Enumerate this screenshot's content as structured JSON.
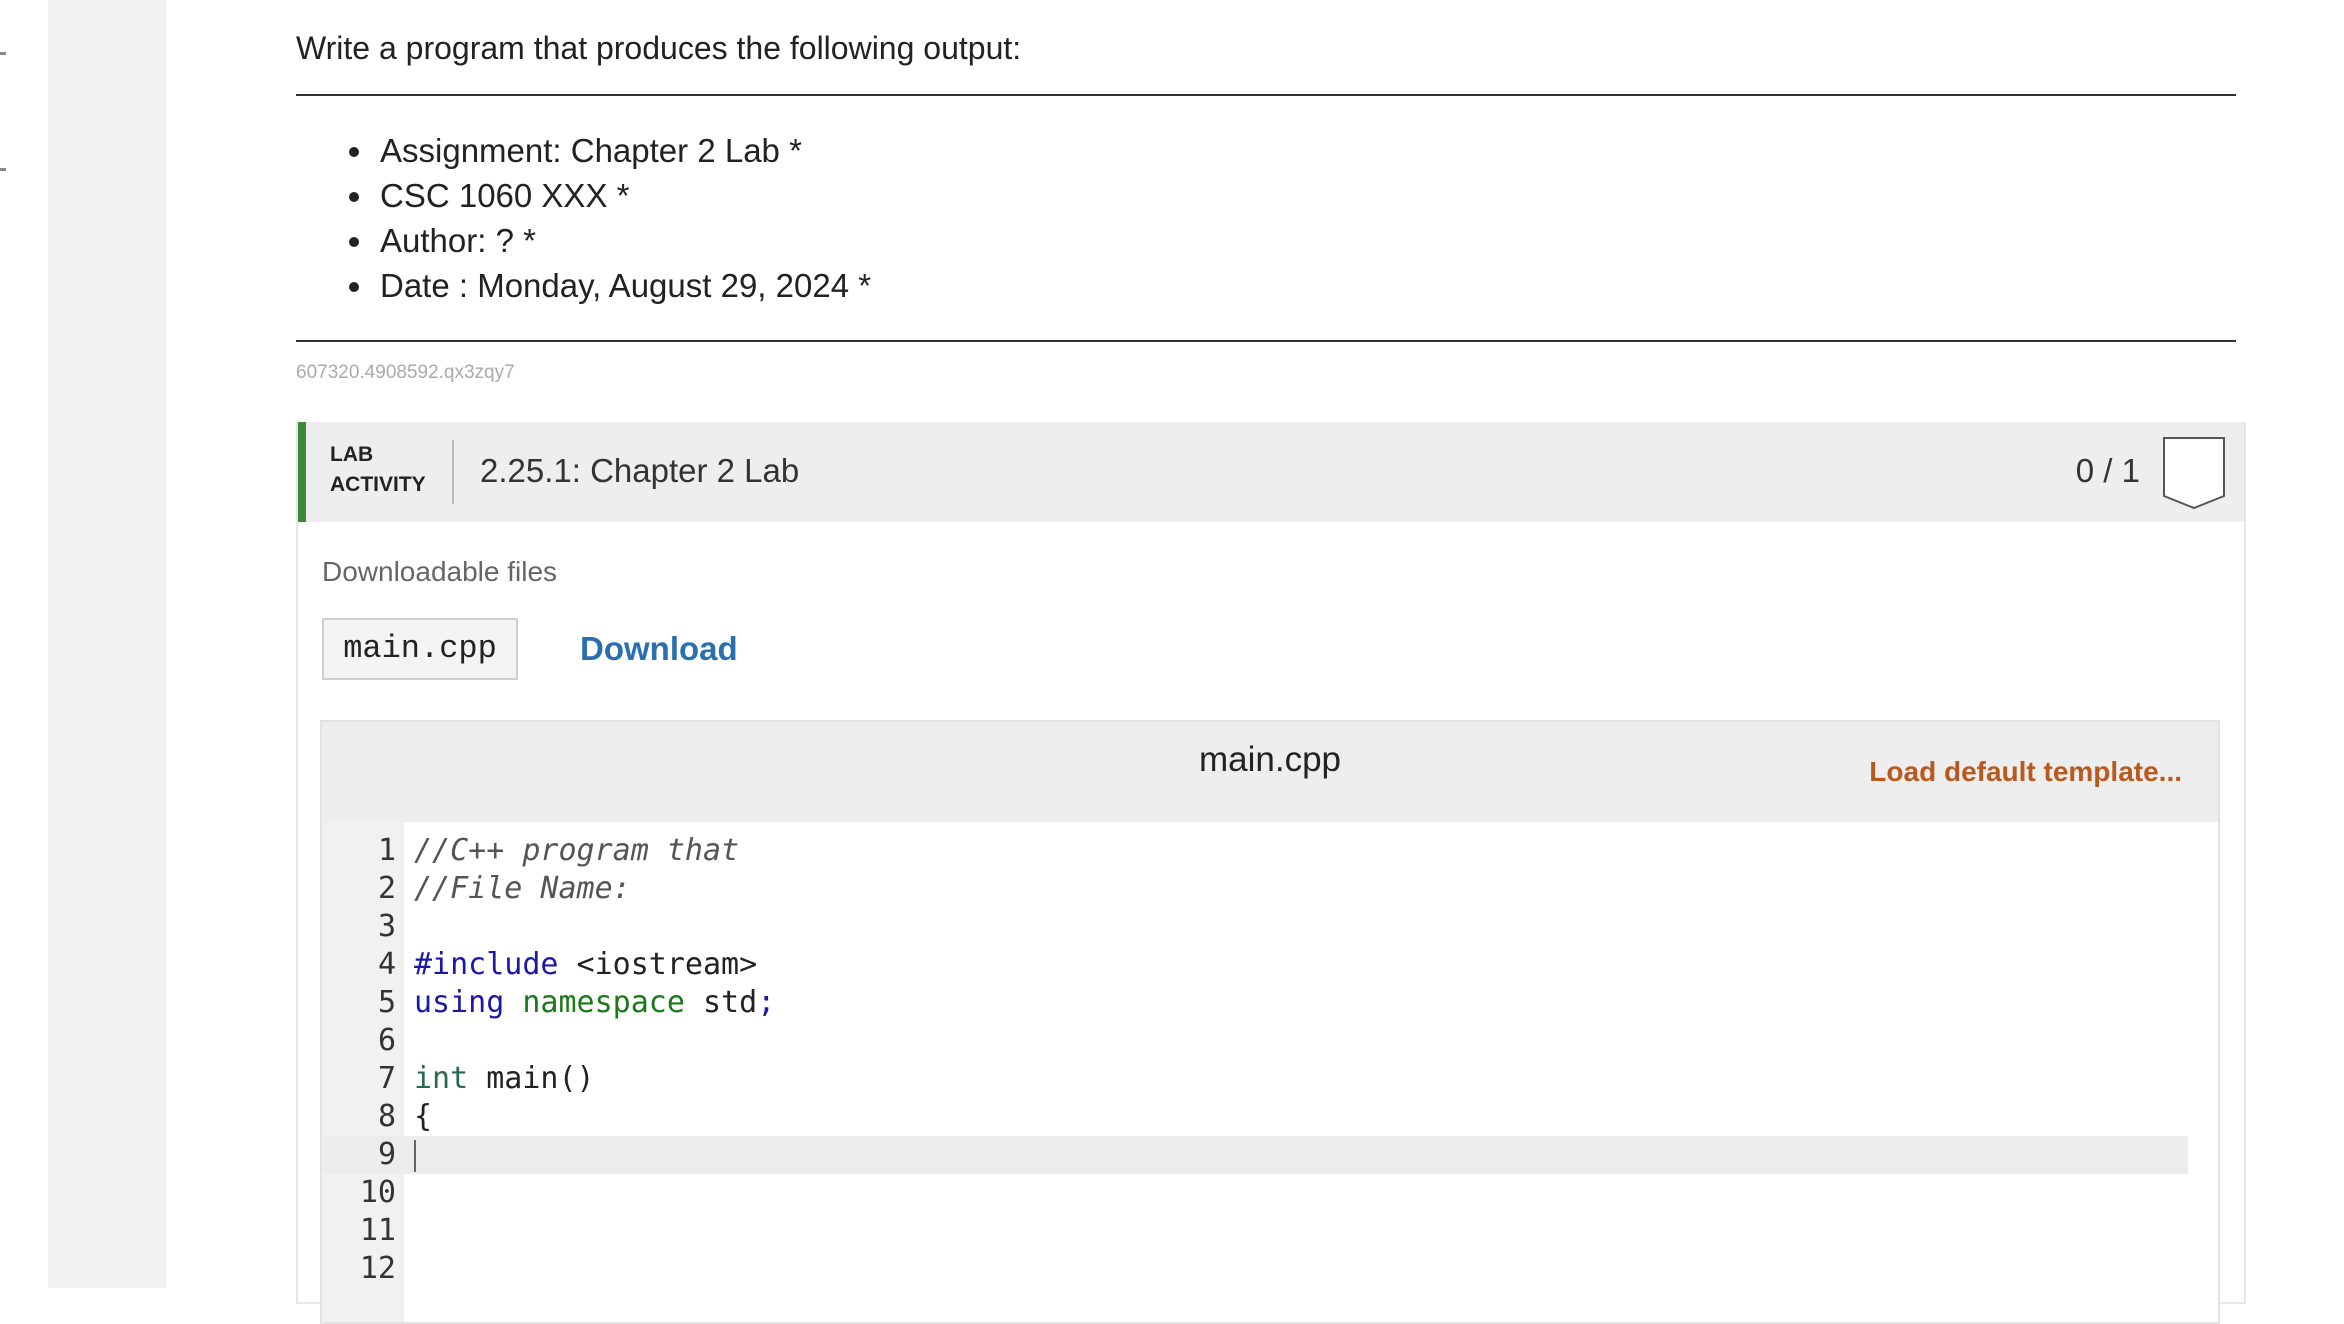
{
  "prompt": "Write a program that produces the following output:",
  "output_lines": [
    "Assignment: Chapter 2 Lab *",
    "CSC 1060 XXX *",
    "Author: ? *",
    "Date : Monday, August 29, 2024 *"
  ],
  "activity_id": "607320.4908592.qx3zqy7",
  "lab": {
    "tag_line1": "LAB",
    "tag_line2": "ACTIVITY",
    "title": "2.25.1: Chapter 2 Lab",
    "score": "0 / 1",
    "downloads_label": "Downloadable files",
    "file_name": "main.cpp",
    "download_label": "Download"
  },
  "editor": {
    "filename": "main.cpp",
    "load_template_label": "Load default template...",
    "line_numbers": [
      "1",
      "2",
      "3",
      "4",
      "5",
      "6",
      "7",
      "8",
      "9",
      "10",
      "11",
      "12"
    ],
    "code": {
      "l1": "//C++ program that",
      "l2": "//File Name:",
      "l4_directive": "#include",
      "l4_header": " <iostream>",
      "l5_using": "using",
      "l5_namespace": " namespace",
      "l5_rest": " std",
      "l5_semicolon": ";",
      "l7_type": "int",
      "l7_rest": " main()",
      "l8": "{"
    }
  },
  "colors": {
    "accent_green": "#3a8a3a",
    "link_blue": "#2a6fb0",
    "template_orange": "#b85a1e"
  }
}
